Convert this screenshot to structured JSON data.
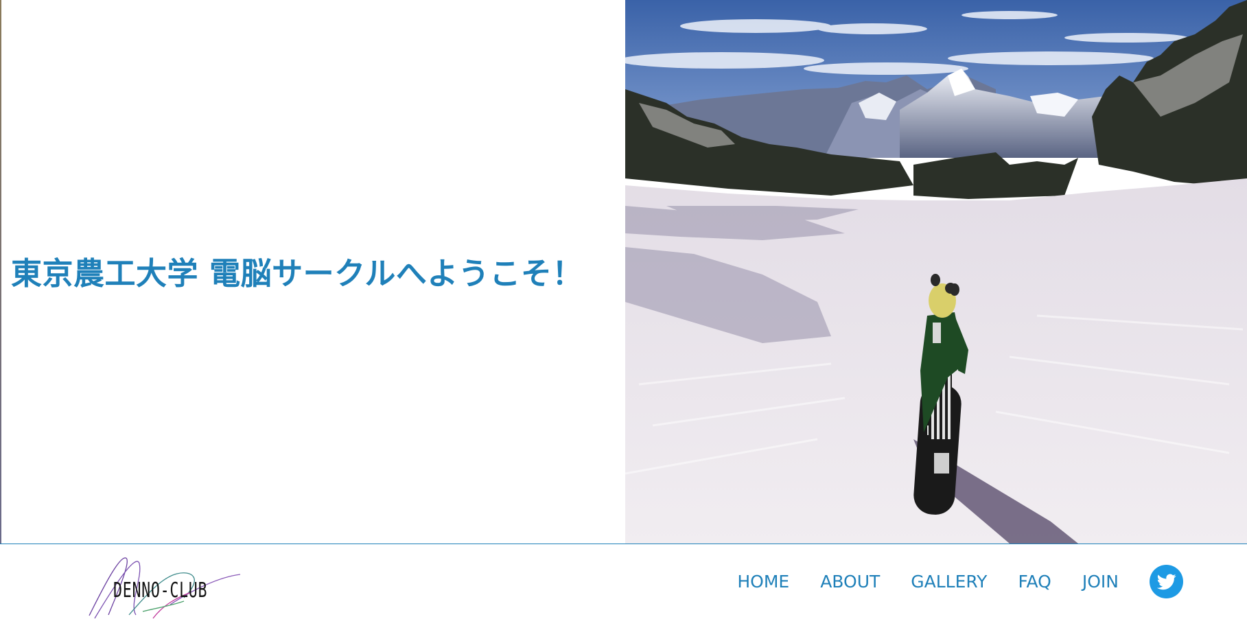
{
  "hero": {
    "welcome_text": "東京農工大学 電脳サークルへようこそ！",
    "image_icon": "snowboarder-mountain-scene"
  },
  "logo": {
    "text": "DENNO-CLUB",
    "icon": "denno-club-logo"
  },
  "nav": {
    "items": [
      {
        "label": "HOME"
      },
      {
        "label": "ABOUT"
      },
      {
        "label": "GALLERY"
      },
      {
        "label": "FAQ"
      },
      {
        "label": "JOIN"
      }
    ],
    "social_icon": "twitter-icon"
  },
  "colors": {
    "accent": "#1f80b9",
    "twitter": "#1d9ae4",
    "background": "#ffffff"
  }
}
